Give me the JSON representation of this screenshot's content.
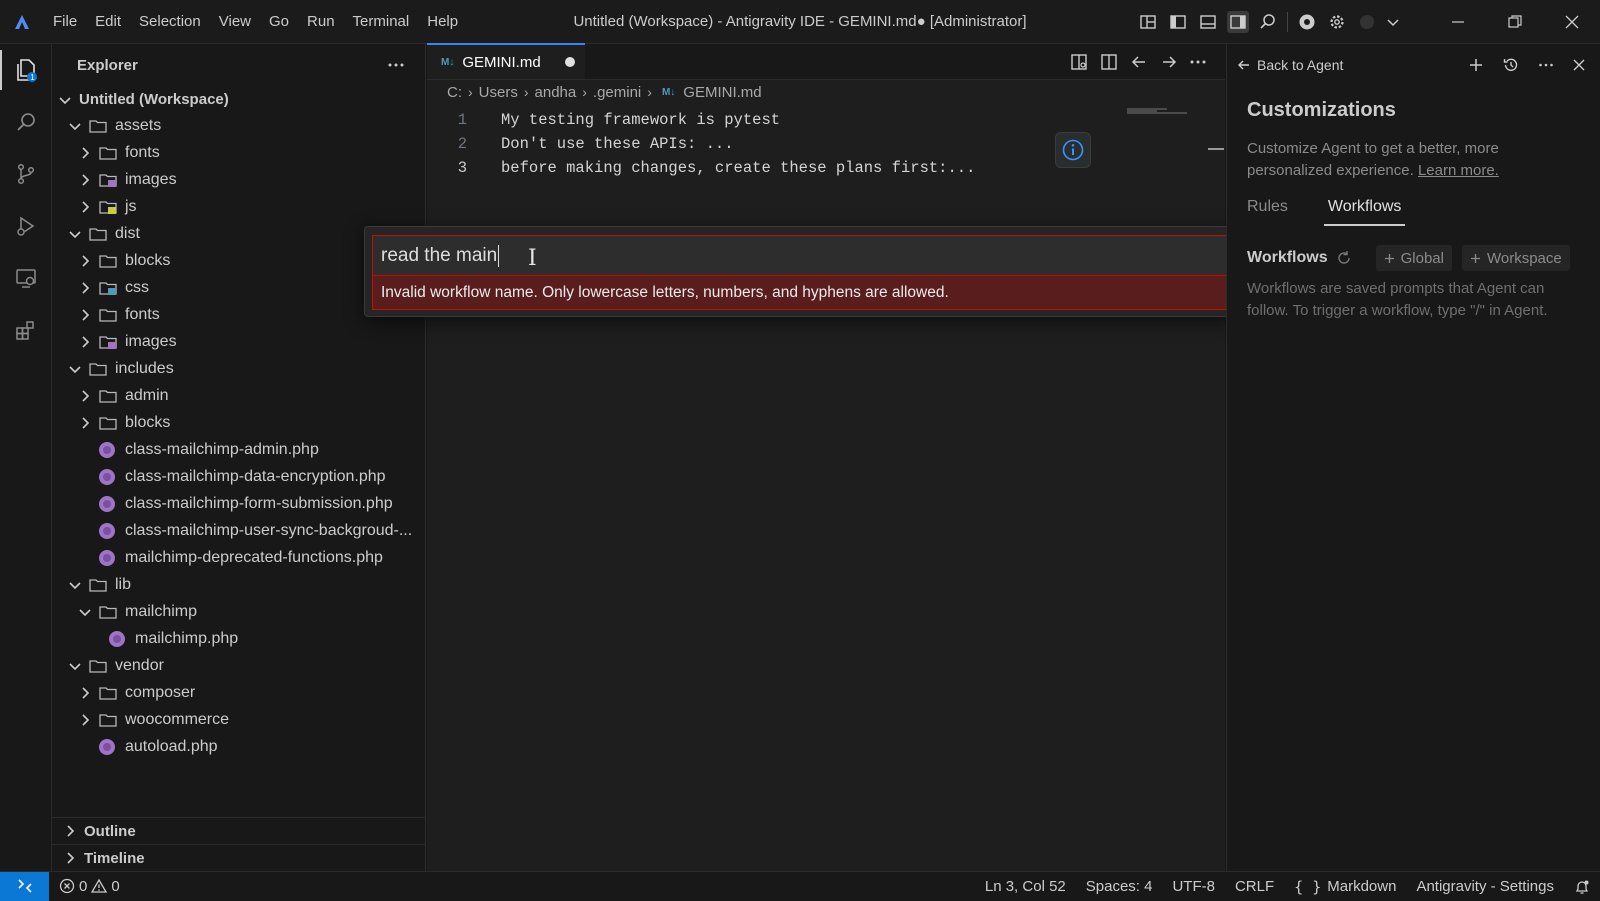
{
  "titlebar": {
    "menu": [
      "File",
      "Edit",
      "Selection",
      "View",
      "Go",
      "Run",
      "Terminal",
      "Help"
    ],
    "window_title": "Untitled (Workspace) - Antigravity IDE - GEMINI.md● [Administrator]"
  },
  "explorer": {
    "title": "Explorer",
    "workspace": "Untitled (Workspace)",
    "tree": [
      {
        "label": "assets",
        "type": "folder",
        "depth": 1,
        "expanded": true
      },
      {
        "label": "fonts",
        "type": "folder",
        "depth": 2,
        "expanded": false
      },
      {
        "label": "images",
        "type": "folder-images",
        "depth": 2,
        "expanded": false
      },
      {
        "label": "js",
        "type": "folder-js",
        "depth": 2,
        "expanded": false
      },
      {
        "label": "dist",
        "type": "folder",
        "depth": 1,
        "expanded": true
      },
      {
        "label": "blocks",
        "type": "folder",
        "depth": 2,
        "expanded": false
      },
      {
        "label": "css",
        "type": "folder-css",
        "depth": 2,
        "expanded": false
      },
      {
        "label": "fonts",
        "type": "folder",
        "depth": 2,
        "expanded": false
      },
      {
        "label": "images",
        "type": "folder-images",
        "depth": 2,
        "expanded": false
      },
      {
        "label": "includes",
        "type": "folder",
        "depth": 1,
        "expanded": true
      },
      {
        "label": "admin",
        "type": "folder",
        "depth": 2,
        "expanded": false
      },
      {
        "label": "blocks",
        "type": "folder",
        "depth": 2,
        "expanded": false
      },
      {
        "label": "class-mailchimp-admin.php",
        "type": "php",
        "depth": 2
      },
      {
        "label": "class-mailchimp-data-encryption.php",
        "type": "php",
        "depth": 2
      },
      {
        "label": "class-mailchimp-form-submission.php",
        "type": "php",
        "depth": 2
      },
      {
        "label": "class-mailchimp-user-sync-backgroud-...",
        "type": "php",
        "depth": 2
      },
      {
        "label": "mailchimp-deprecated-functions.php",
        "type": "php",
        "depth": 2
      },
      {
        "label": "lib",
        "type": "folder",
        "depth": 1,
        "expanded": true
      },
      {
        "label": "mailchimp",
        "type": "folder",
        "depth": 2,
        "expanded": true
      },
      {
        "label": "mailchimp.php",
        "type": "php",
        "depth": 3
      },
      {
        "label": "vendor",
        "type": "folder",
        "depth": 1,
        "expanded": true
      },
      {
        "label": "composer",
        "type": "folder",
        "depth": 2,
        "expanded": false
      },
      {
        "label": "woocommerce",
        "type": "folder",
        "depth": 2,
        "expanded": false
      },
      {
        "label": "autoload.php",
        "type": "php",
        "depth": 2
      }
    ],
    "outline": "Outline",
    "timeline": "Timeline"
  },
  "editor": {
    "tab_label": "GEMINI.md",
    "tab_icon": "M↓",
    "breadcrumb": [
      "C:",
      "Users",
      "andha",
      ".gemini",
      "GEMINI.md"
    ],
    "lines": [
      {
        "num": "1",
        "text": "My testing framework is pytest"
      },
      {
        "num": "2",
        "text": "Don't use these APIs: ..."
      },
      {
        "num": "3",
        "text": "before making changes, create these plans first:..."
      }
    ]
  },
  "quick_input": {
    "value": "read the main",
    "error": "Invalid workflow name. Only lowercase letters, numbers, and hyphens are allowed."
  },
  "agent_panel": {
    "back_label": "Back to Agent",
    "title": "Customizations",
    "description": "Customize Agent to get a better, more personalized experience.",
    "learn_more": "Learn more.",
    "tabs": [
      "Rules",
      "Workflows"
    ],
    "active_tab": "Workflows",
    "workflows_label": "Workflows",
    "global_button": "Global",
    "workspace_button": "Workspace",
    "workflows_description": "Workflows are saved prompts that Agent can follow. To trigger a workflow, type \"/\" in Agent."
  },
  "statusbar": {
    "errors": "0",
    "warnings": "0",
    "cursor_position": "Ln 3, Col 52",
    "spaces": "Spaces: 4",
    "encoding": "UTF-8",
    "eol": "CRLF",
    "language": "Markdown",
    "settings": "Antigravity - Settings"
  },
  "colors": {
    "accent": "#0a78d4",
    "error_bg": "#5a1d1d",
    "error_border": "#be1100",
    "php_icon": "#a074c4",
    "markdown_icon": "#519aba"
  }
}
